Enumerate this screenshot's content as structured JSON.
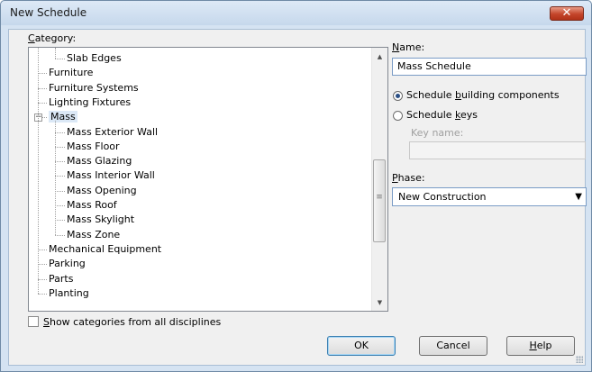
{
  "window": {
    "title": "New Schedule",
    "close_label": "✕"
  },
  "category": {
    "label_first": "C",
    "label_rest": "ategory:",
    "items": [
      {
        "label": "Slab Edges",
        "level": 2
      },
      {
        "label": "Furniture",
        "level": 1
      },
      {
        "label": "Furniture Systems",
        "level": 1
      },
      {
        "label": "Lighting Fixtures",
        "level": 1
      },
      {
        "label": "Mass",
        "level": 1,
        "expanded": true,
        "selected": true
      },
      {
        "label": "Mass Exterior Wall",
        "level": 2
      },
      {
        "label": "Mass Floor",
        "level": 2
      },
      {
        "label": "Mass Glazing",
        "level": 2
      },
      {
        "label": "Mass Interior Wall",
        "level": 2
      },
      {
        "label": "Mass Opening",
        "level": 2
      },
      {
        "label": "Mass Roof",
        "level": 2
      },
      {
        "label": "Mass Skylight",
        "level": 2
      },
      {
        "label": "Mass Zone",
        "level": 2
      },
      {
        "label": "Mechanical Equipment",
        "level": 1
      },
      {
        "label": "Parking",
        "level": 1
      },
      {
        "label": "Parts",
        "level": 1
      },
      {
        "label": "Planting",
        "level": 1
      }
    ],
    "expander_symbol": "−"
  },
  "show_all": {
    "label_first": "S",
    "label_rest": "how categories from all disciplines",
    "checked": false
  },
  "name": {
    "label_first": "N",
    "label_rest": "ame:",
    "value": "Mass Schedule"
  },
  "schedule_type": {
    "building": {
      "pre": "Schedule ",
      "accel": "b",
      "post": "uilding components",
      "selected": true
    },
    "keys": {
      "pre": "Schedule ",
      "accel": "k",
      "post": "eys",
      "selected": false
    }
  },
  "key_name": {
    "label": "Key name:",
    "value": ""
  },
  "phase": {
    "label_first": "P",
    "label_rest": "hase:",
    "value": "New Construction"
  },
  "buttons": {
    "ok": "OK",
    "cancel": "Cancel",
    "help_first": "H",
    "help_rest": "elp"
  },
  "icons": {
    "up": "▲",
    "down": "▼",
    "grip": "≡",
    "dropdown": "▼"
  }
}
